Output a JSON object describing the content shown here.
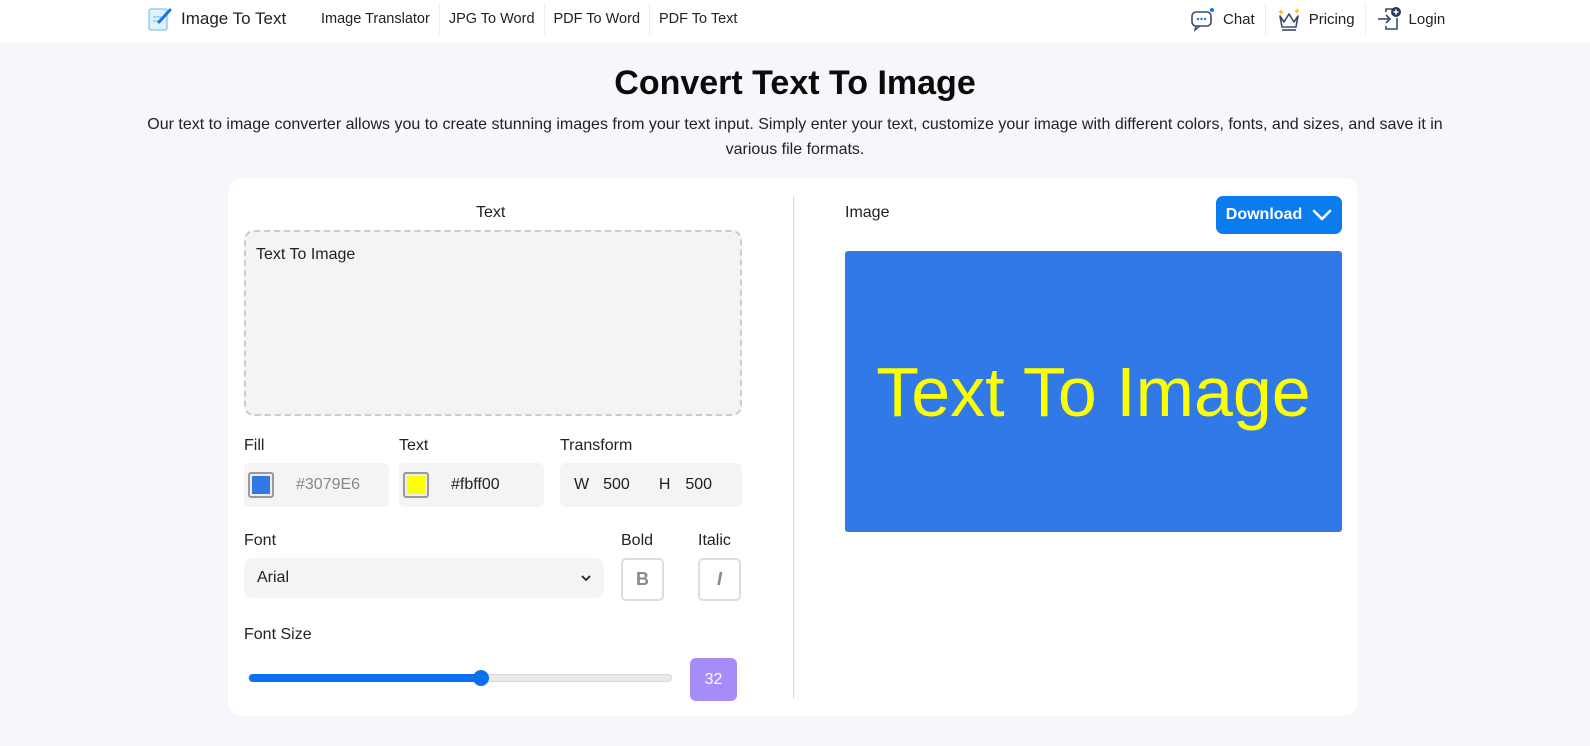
{
  "nav": {
    "logo_text": "Image To Text",
    "links": [
      "Image Translator",
      "JPG To Word",
      "PDF To Word",
      "PDF To Text"
    ],
    "right": [
      {
        "label": "Chat",
        "icon": "chat-icon"
      },
      {
        "label": "Pricing",
        "icon": "crown-icon"
      },
      {
        "label": "Login",
        "icon": "login-icon"
      }
    ]
  },
  "page": {
    "title": "Convert Text To Image",
    "subtitle": "Our text to image converter allows you to create stunning images from your text input. Simply enter your text, customize your image with different colors, fonts, and sizes, and save it in various file formats."
  },
  "editor": {
    "text_label": "Text",
    "text_value": "Text To Image",
    "fill_label": "Fill",
    "fill_color": "#3079E6",
    "text_color_label": "Text",
    "text_color": "#fbff00",
    "transform_label": "Transform",
    "w_label": "W",
    "w_value": "500",
    "h_label": "H",
    "h_value": "500",
    "font_label": "Font",
    "font_value": "Arial",
    "bold_label": "Bold",
    "bold_glyph": "B",
    "italic_label": "Italic",
    "italic_glyph": "I",
    "font_size_label": "Font Size",
    "font_size_value": "32",
    "font_size_slider_fraction": 0.55
  },
  "output": {
    "image_label": "Image",
    "download_label": "Download",
    "preview_text": "Text To Image",
    "preview_bg": "#3079E6",
    "preview_fg": "#fbff00"
  }
}
